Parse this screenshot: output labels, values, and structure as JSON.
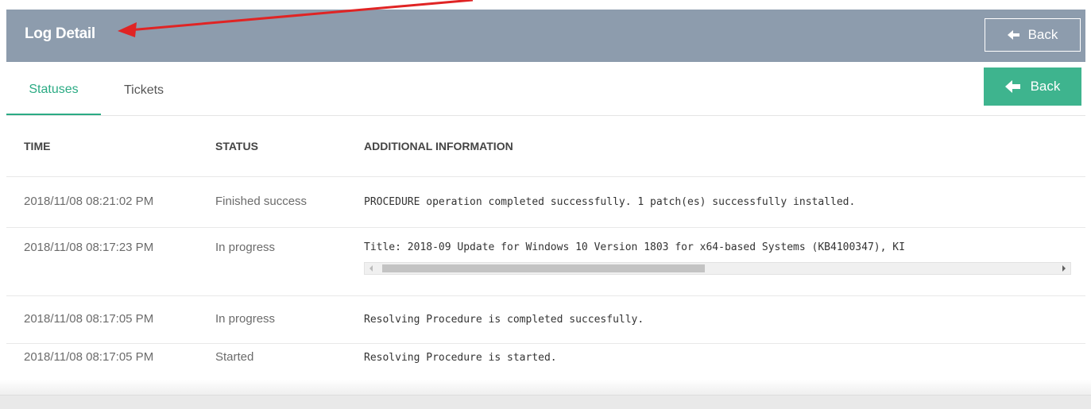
{
  "header": {
    "title": "Log Detail",
    "back_label": "Back"
  },
  "tabs": [
    {
      "label": "Statuses",
      "active": true
    },
    {
      "label": "Tickets",
      "active": false
    }
  ],
  "actions": {
    "back_label": "Back"
  },
  "colors": {
    "header_bg": "#8d9cad",
    "accent": "#2bab84",
    "button_green": "#3eb48e",
    "annotation_red": "#e02424"
  },
  "icons": [
    "arrow-left-icon",
    "annotation-arrow"
  ],
  "table": {
    "columns": [
      "TIME",
      "STATUS",
      "ADDITIONAL INFORMATION"
    ],
    "rows": [
      {
        "time": "2018/11/08 08:21:02 PM",
        "status": "Finished success",
        "info": "PROCEDURE operation completed successfully. 1 patch(es) successfully installed."
      },
      {
        "time": "2018/11/08 08:17:23 PM",
        "status": "In progress",
        "info": "Title: 2018-09 Update for Windows 10 Version 1803 for x64-based Systems (KB4100347), KI"
      },
      {
        "time": "2018/11/08 08:17:05 PM",
        "status": "In progress",
        "info": "Resolving Procedure is completed succesfully."
      },
      {
        "time": "2018/11/08 08:17:05 PM",
        "status": "Started",
        "info": "Resolving Procedure is started."
      }
    ]
  }
}
